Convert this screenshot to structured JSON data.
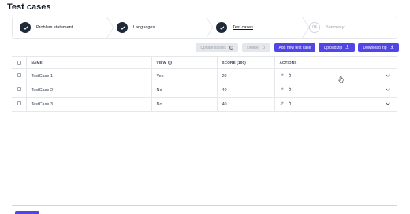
{
  "page": {
    "title": "Test cases"
  },
  "steps": [
    {
      "label": "Problem statement",
      "state": "done"
    },
    {
      "label": "Languages",
      "state": "done"
    },
    {
      "label": "Test cases",
      "state": "current"
    },
    {
      "number": "04",
      "label": "Summary",
      "state": "todo"
    }
  ],
  "toolbar": {
    "update_scores": "Update scores",
    "delete": "Delete",
    "add": "Add new test case",
    "upload": "Upload zip",
    "download": "Download zip"
  },
  "table": {
    "headers": {
      "name": "NAME",
      "view": "VIEW",
      "score": "SCORE (100)",
      "actions": "ACTIONS"
    },
    "rows": [
      {
        "name": "TestCase 1",
        "view": "Yes",
        "score": "20"
      },
      {
        "name": "TestCase 2",
        "view": "No",
        "score": "40"
      },
      {
        "name": "TestCase 3",
        "view": "No",
        "score": "40"
      }
    ]
  },
  "colors": {
    "primary": "#4f46e5",
    "step_done": "#1f2937"
  },
  "icons": {
    "step_done": "check-icon",
    "info": "info-icon",
    "edit": "pencil-icon",
    "delete": "trash-icon",
    "expand": "chevron-down-icon",
    "upload": "upload-icon",
    "download": "download-icon"
  }
}
